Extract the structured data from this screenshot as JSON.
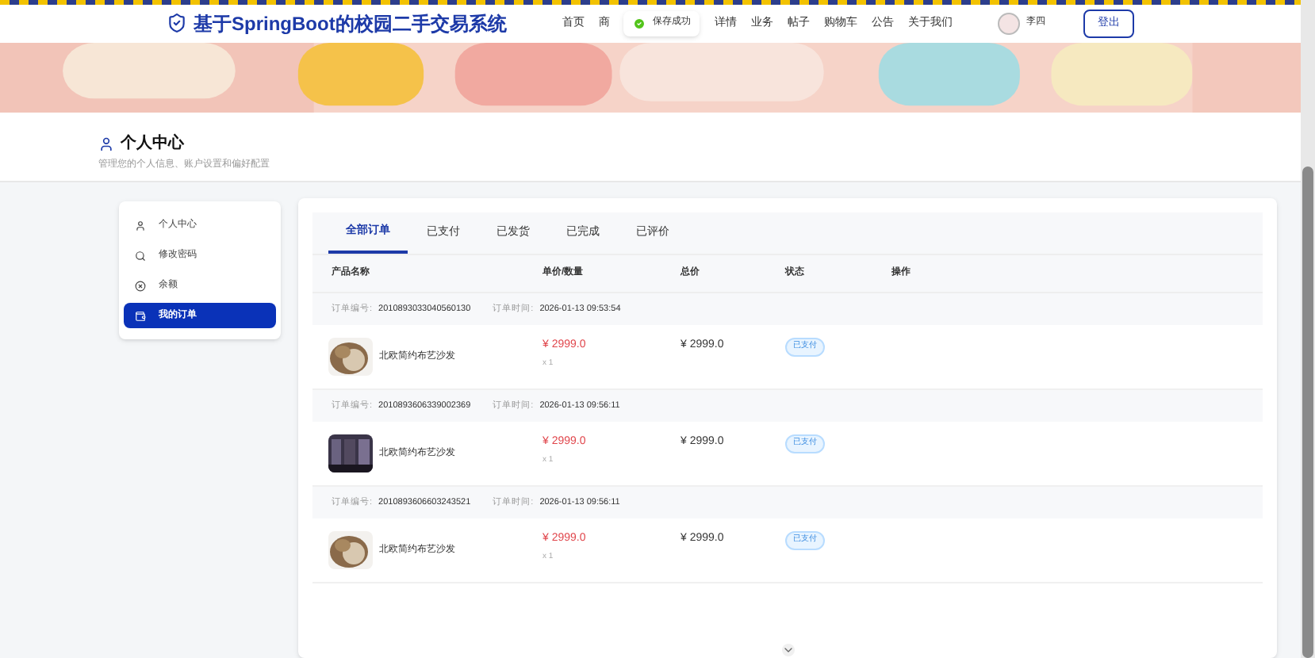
{
  "site_title": "基于SpringBoot的校园二手交易系统",
  "nav": [
    "首页",
    "商",
    "详情",
    "业务",
    "帖子",
    "购物车",
    "公告",
    "关于我们"
  ],
  "toast": "保存成功",
  "user": {
    "name": "李四"
  },
  "logout": "登出",
  "page": {
    "title": "个人中心",
    "subtitle": "管理您的个人信息、账户设置和偏好配置"
  },
  "sidebar": {
    "items": [
      {
        "label": "个人中心",
        "kind": "profile",
        "selected": false
      },
      {
        "label": "修改密码",
        "kind": "password",
        "selected": false
      },
      {
        "label": "余额",
        "kind": "balance",
        "selected": false
      },
      {
        "label": "我的订单",
        "kind": "orders",
        "selected": true
      }
    ]
  },
  "tabs": [
    {
      "label": "全部订单",
      "selected": true
    },
    {
      "label": "已支付",
      "selected": false
    },
    {
      "label": "已发货",
      "selected": false
    },
    {
      "label": "已完成",
      "selected": false
    },
    {
      "label": "已评价",
      "selected": false
    }
  ],
  "table": {
    "columns": [
      "产品名称",
      "单价/数量",
      "总价",
      "状态",
      "操作"
    ],
    "orders": [
      {
        "no_label": "订单编号:",
        "no": "2010893033040560130",
        "time_label": "订单时间:",
        "time": "2026-01-13 09:53:54",
        "product": "北欧简约布艺沙发",
        "price": "¥ 2999.0",
        "qty": "x 1",
        "total": "¥ 2999.0",
        "status": "已支付",
        "kind": "picture"
      },
      {
        "no_label": "订单编号:",
        "no": "2010893606339002369",
        "time_label": "订单时间:",
        "time": "2026-01-13 09:56:11",
        "product": "北欧简约布艺沙发",
        "price": "¥ 2999.0",
        "qty": "x 1",
        "total": "¥ 2999.0",
        "status": "已支付",
        "kind": "picture"
      },
      {
        "no_label": "订单编号:",
        "no": "2010893606603243521",
        "time_label": "订单时间:",
        "time": "2026-01-13 09:56:11",
        "product": "北欧简约布艺沙发",
        "price": "¥ 2999.0",
        "qty": "x 1",
        "total": "¥ 2999.0",
        "status": "已支付",
        "kind": "picture"
      }
    ]
  }
}
